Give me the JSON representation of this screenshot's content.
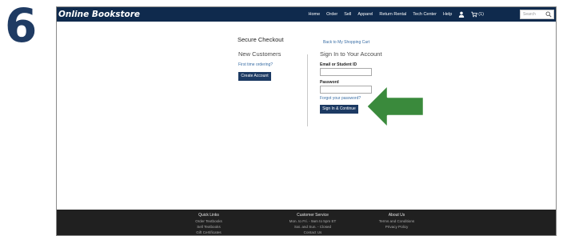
{
  "step_number": "6",
  "header": {
    "logo": "Online Bookstore",
    "nav_items": [
      "Home",
      "Order",
      "Sell",
      "Apparel",
      "Return Rental",
      "Tech Center",
      "Help"
    ],
    "cart_count": "(1)",
    "search": {
      "placeholder": "Search"
    },
    "icons": [
      "user-icon",
      "cart-icon",
      "search-icon"
    ]
  },
  "checkout": {
    "title": "Secure Checkout",
    "back_link": "Back to My Shopping Cart",
    "new_customers": {
      "heading": "New Customers",
      "prompt": "First time ordering?",
      "button": "Create Account"
    },
    "sign_in": {
      "heading": "Sign In to Your Account",
      "email_label": "Email or Student ID",
      "email_value": "",
      "password_label": "Password",
      "password_value": "",
      "forgot_link": "Forgot your password?",
      "button": "Sign In & Continue"
    }
  },
  "annotation": {
    "arrow_color": "#3a8a3c"
  },
  "footer": {
    "columns": [
      {
        "heading": "Quick Links",
        "items": [
          "Order Textbooks",
          "Sell Textbooks",
          "Gift Certificates"
        ]
      },
      {
        "heading": "Customer Service",
        "items": [
          "Mon. to Fri. - 9am to 5pm ET",
          "Sat. and Sun. - Closed",
          "Contact Us"
        ]
      },
      {
        "heading": "About Us",
        "items": [
          "Terms and Conditions",
          "Privacy Policy"
        ]
      }
    ]
  },
  "colors": {
    "navbar": "#0f2a4d",
    "button": "#1c3a63",
    "link": "#3a6ea5",
    "footer": "#202020",
    "step_number": "#1f3b63"
  }
}
